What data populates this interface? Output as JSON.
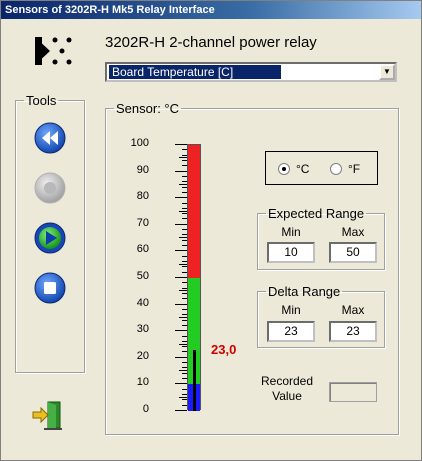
{
  "window": {
    "title": "Sensors of 3202R-H Mk5 Relay   Interface"
  },
  "header": {
    "device_title": "3202R-H  2-channel power relay",
    "sensor_select": {
      "selected": "Board Temperature [C]"
    }
  },
  "tools": {
    "label": "Tools",
    "buttons": [
      {
        "name": "rewind",
        "icon": "rewind-icon",
        "enabled": true
      },
      {
        "name": "record",
        "icon": "record-icon",
        "enabled": false
      },
      {
        "name": "play",
        "icon": "play-icon",
        "enabled": true
      },
      {
        "name": "stop",
        "icon": "stop-icon",
        "enabled": true
      }
    ],
    "exit_icon": "exit-door-icon"
  },
  "sensor": {
    "label": "Sensor: °C",
    "scale": [
      "100",
      "90",
      "80",
      "70",
      "60",
      "50",
      "40",
      "30",
      "20",
      "10",
      "0"
    ],
    "scale_min": 0,
    "scale_max": 100,
    "zones": [
      {
        "from": 0,
        "to": 10,
        "color": "#1a1aff"
      },
      {
        "from": 10,
        "to": 50,
        "color": "#22cc22"
      },
      {
        "from": 50,
        "to": 100,
        "color": "#ee2222"
      }
    ],
    "current_value": 23.0,
    "current_value_text": "23,0",
    "value_color": "#cc0000"
  },
  "units": {
    "celsius_label": "°C",
    "fahrenheit_label": "°F",
    "selected": "celsius"
  },
  "expected_range": {
    "label": "Expected Range",
    "min_label": "Min",
    "max_label": "Max",
    "min": "10",
    "max": "50"
  },
  "delta_range": {
    "label": "Delta Range",
    "min_label": "Min",
    "max_label": "Max",
    "min": "23",
    "max": "23"
  },
  "recorded": {
    "label_line1": "Recorded",
    "label_line2": "Value",
    "value": ""
  }
}
